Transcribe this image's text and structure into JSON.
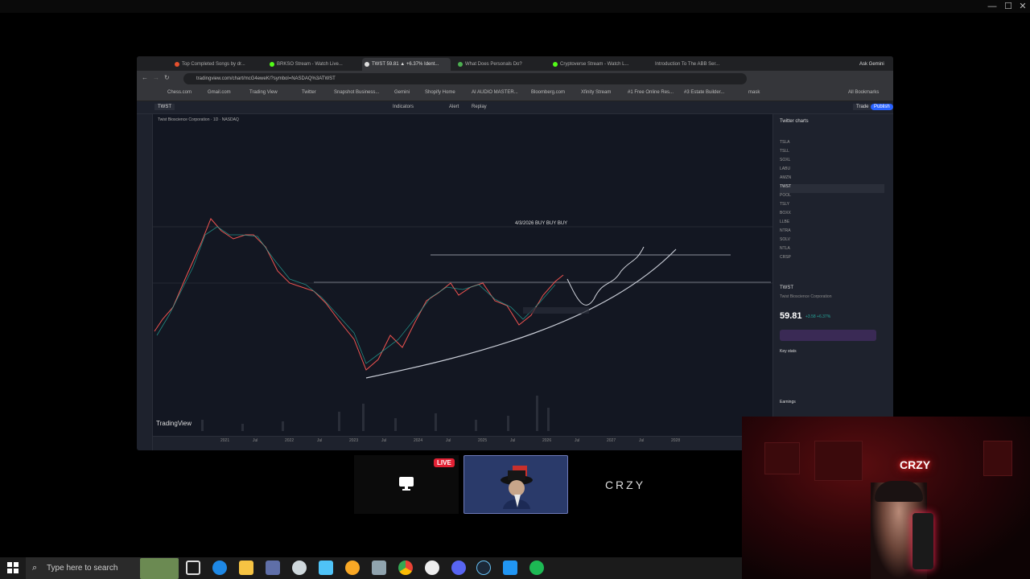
{
  "window": {
    "minimize": "—",
    "maximize": "☐",
    "close": "✕"
  },
  "browser": {
    "tabs": [
      "Top Completed Songs by dr...",
      "BRKSO Stream - Watch Live...",
      "TWST 59.81 ▲ +6.37% Ident...",
      "What Does Personals Do?",
      "Cryptoverse Stream - Watch L...",
      "Introduction To The ABB Ser..."
    ],
    "gemini_label": "Ask Gemini",
    "url": "tradingview.com/chart/mcG4eweK/?symbol=NASDAQ%3ATWST",
    "bookmarks": [
      "Chess.com",
      "Gmail.com",
      "Trading View",
      "Twitter",
      "Snapshot Business...",
      "Gemini",
      "Shopify Home",
      "AI AUDIO MASTER...",
      "Bloomberg.com",
      "Xfinity Stream",
      "#1 Free Online Res...",
      "#3 Estate Builder...",
      "mask"
    ],
    "all_bookmarks": "All Bookmarks"
  },
  "tradingview": {
    "symbol_box": "TWST",
    "indicators_label": "Indicators",
    "alert_label": "Alert",
    "replay_label": "Replay",
    "trade_label": "Trade",
    "publish_label": "Publish",
    "instrument_title": "Twist Bioscience Corporation · 1D · NASDAQ",
    "annotation": "4/3/2026 BUY BUY BUY",
    "logo": "TradingView",
    "x_labels": [
      "2021",
      "Jul",
      "2022",
      "Jul",
      "2023",
      "Jul",
      "2024",
      "Jul",
      "2025",
      "Jul",
      "2026",
      "Jul",
      "2027",
      "Jul",
      "2028"
    ],
    "watchlist_title": "Twitter charts",
    "watchlist_rows": [
      "TSLA",
      "TSLL",
      "SOXL",
      "LABU",
      "AMZN",
      "TWST",
      "POOL",
      "TSLY",
      "BOXX",
      "LLBE",
      "NTRA",
      "SOLV",
      "NTLA",
      "CRSP"
    ],
    "detail_symbol": "TWST",
    "detail_name": "Twist Bioscience Corporation",
    "detail_price": "59.81",
    "detail_change": "+3.58 +6.37%",
    "key_stats": "Key stats",
    "earnings": "Earnings"
  },
  "stream": {
    "live_badge": "LIVE",
    "channel_name": "CRZY",
    "neon_sign": "CRZY"
  },
  "taskbar": {
    "search_placeholder": "Type here to search"
  },
  "colors": {
    "accent_red": "#e22134",
    "chart_up": "#26a69a",
    "chart_down": "#ef5350",
    "avatar_bg": "#2a3a6a"
  }
}
